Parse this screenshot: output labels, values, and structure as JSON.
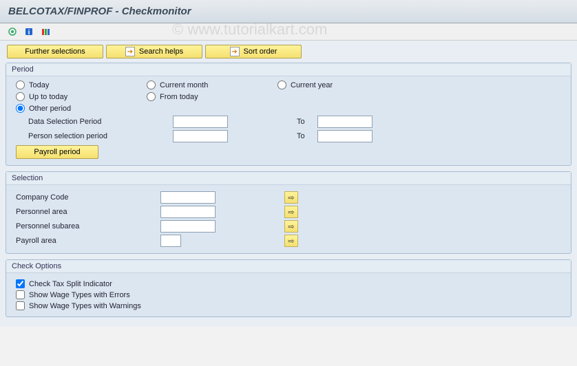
{
  "header": {
    "title": "BELCOTAX/FINPROF - Checkmonitor"
  },
  "watermark": "© www.tutorialkart.com",
  "toolbar": {
    "further_selections": "Further selections",
    "search_helps": "Search helps",
    "sort_order": "Sort order"
  },
  "period": {
    "title": "Period",
    "today": "Today",
    "current_month": "Current month",
    "current_year": "Current year",
    "up_to_today": "Up to today",
    "from_today": "From today",
    "other_period": "Other period",
    "data_selection_period": "Data Selection Period",
    "person_selection_period": "Person selection period",
    "to": "To",
    "payroll_period": "Payroll period",
    "values": {
      "data_sel_from": "",
      "data_sel_to": "",
      "person_sel_from": "",
      "person_sel_to": ""
    }
  },
  "selection": {
    "title": "Selection",
    "company_code": "Company Code",
    "personnel_area": "Personnel area",
    "personnel_subarea": "Personnel subarea",
    "payroll_area": "Payroll area",
    "values": {
      "company_code": "",
      "personnel_area": "",
      "personnel_subarea": "",
      "payroll_area": ""
    }
  },
  "check_options": {
    "title": "Check Options",
    "check_tax_split": "Check Tax Split Indicator",
    "show_errors": "Show Wage Types with Errors",
    "show_warnings": "Show Wage Types with Warnings"
  }
}
